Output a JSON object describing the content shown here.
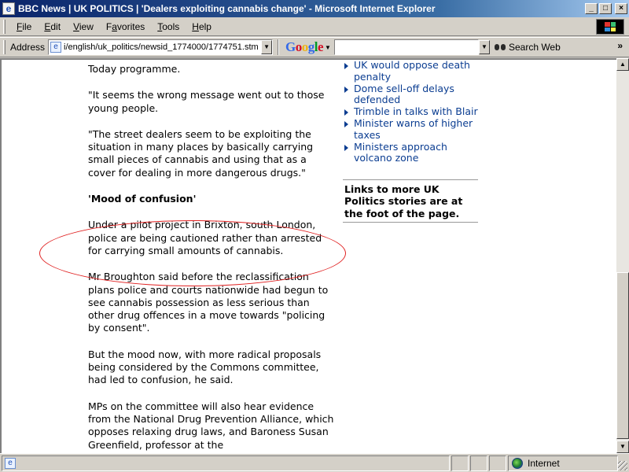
{
  "window": {
    "title": "BBC News | UK POLITICS | 'Dealers exploiting cannabis change' - Microsoft Internet Explorer",
    "app_icon": "bbc-page-icon",
    "buttons": {
      "minimize": "_",
      "maximize": "□",
      "close": "×"
    }
  },
  "menu": {
    "items": [
      {
        "hotkey": "F",
        "rest": "ile"
      },
      {
        "hotkey": "E",
        "rest": "dit"
      },
      {
        "hotkey": "V",
        "rest": "iew"
      },
      {
        "hotkey": "",
        "pre": "F",
        "hot2": "a",
        "rest": "vorites"
      },
      {
        "hotkey": "T",
        "rest": "ools"
      },
      {
        "hotkey": "H",
        "rest": "elp"
      }
    ],
    "favorites_label": "Favorites"
  },
  "address": {
    "label": "Address",
    "url": "i/english/uk_politics/newsid_1774000/1774751.stm",
    "google_letters": [
      "G",
      "o",
      "o",
      "g",
      "l",
      "e"
    ],
    "search_value": "",
    "search_web_label": "Search Web",
    "more": "»"
  },
  "article": {
    "paragraphs": [
      "Today programme.",
      "\"It seems the wrong message went out to those young people.",
      "\"The street dealers seem to be exploiting the situation in many places by basically carrying small pieces of cannabis and using that as a cover for dealing in more dangerous drugs.\""
    ],
    "subheading": "'Mood of confusion'",
    "highlighted_paragraph": "Under a pilot project in Brixton, south London, police are being cautioned rather than arrested for carrying small amounts of cannabis.",
    "paragraphs_after": [
      "Mr Broughton said before the reclassification plans police and courts nationwide had begun to see cannabis possession as less serious than other drug offences in a move towards \"policing by consent\".",
      "But the mood now, with more radical proposals being considered by the Commons committee, had led to confusion, he said.",
      "MPs on the committee will also hear evidence from the National Drug Prevention Alliance, which opposes relaxing drug laws, and Baroness Susan Greenfield, professor at the"
    ]
  },
  "sidebar": {
    "links": [
      "UK would oppose death penalty",
      "Dome sell-off delays defended",
      "Trimble in talks with Blair",
      "Minister warns of higher taxes",
      "Ministers approach volcano zone"
    ],
    "note": "Links to more UK Politics stories are at the foot of the page."
  },
  "status": {
    "text": "",
    "zone_label": "Internet",
    "zone_icon": "globe-icon"
  },
  "colors": {
    "titlebar_start": "#0a246a",
    "link": "#0b3d91",
    "highlight_ellipse": "#e02020"
  }
}
